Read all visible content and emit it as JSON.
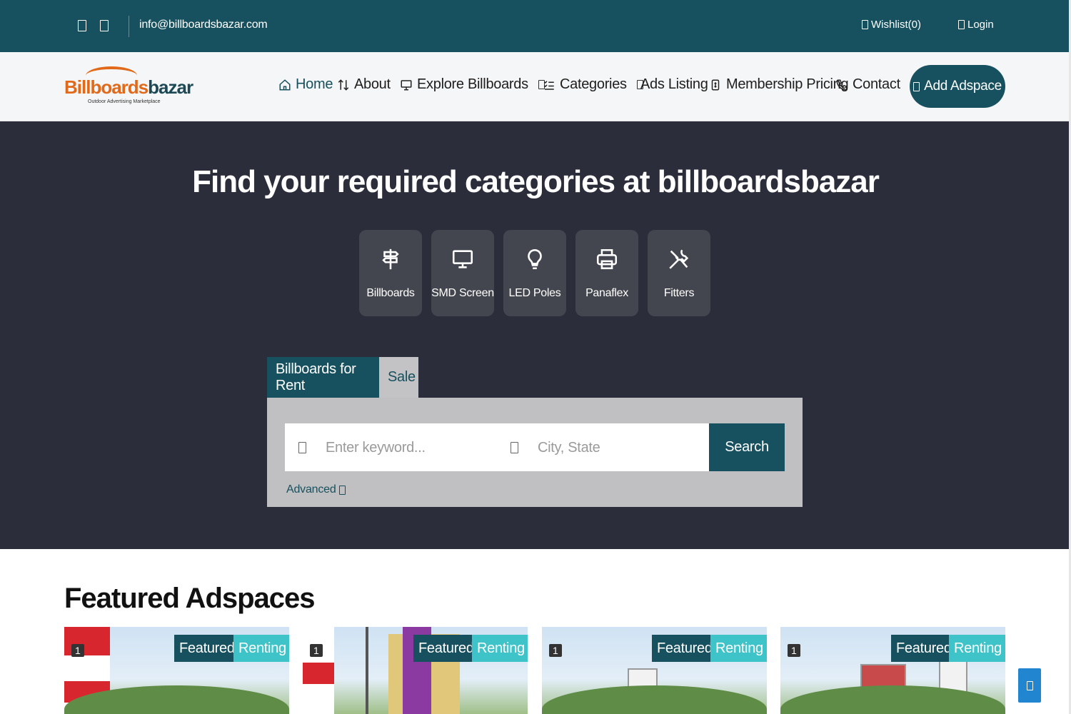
{
  "topbar": {
    "email": "info@billboardsbazar.com",
    "wishlist_label": "Wishlist(0)",
    "login_label": "Login",
    "social_icons": [
      "facebook-icon",
      "instagram-icon"
    ]
  },
  "brand": {
    "logo_part1": "Billboards",
    "logo_part2": "bazar",
    "tagline": "Outdoor Advertising Marketplace",
    "colors": {
      "primary": "#17505e",
      "accent": "#e06a1a",
      "hero_bg": "#2b2d3b",
      "teal_badge": "#3ec3c9"
    }
  },
  "nav": {
    "items": [
      {
        "label": "Home",
        "icon": "home-icon",
        "active": true
      },
      {
        "label": "About",
        "icon": "arrows-icon"
      },
      {
        "label": "Explore Billboards",
        "icon": "monitor-icon",
        "dropdown": true
      },
      {
        "label": "Categories",
        "icon": "list-check-icon",
        "dropdown": true
      },
      {
        "label": "Ads Listing"
      },
      {
        "label": "Membership Pricing",
        "icon": "bill-icon"
      },
      {
        "label": "Contact",
        "icon": "phone-icon"
      }
    ],
    "add_button": "Add Adspace"
  },
  "hero": {
    "title": "Find your required categories at billboardsbazar",
    "categories": [
      {
        "label": "Billboards",
        "icon": "signpost-icon"
      },
      {
        "label": "SMD Screen",
        "icon": "monitor-icon"
      },
      {
        "label": "LED Poles",
        "icon": "lightbulb-icon"
      },
      {
        "label": "Panaflex",
        "icon": "printer-icon"
      },
      {
        "label": "Fitters",
        "icon": "tools-icon"
      }
    ],
    "tabs": [
      "Billboards for Rent",
      "Sale"
    ],
    "search": {
      "keyword_placeholder": "Enter keyword...",
      "location_placeholder": "City, State",
      "button": "Search",
      "advanced": "Advanced"
    }
  },
  "featured": {
    "title": "Featured Adspaces",
    "cards": [
      {
        "badge_featured": "Featured",
        "badge_renting": "Renting",
        "count": "1"
      },
      {
        "badge_featured": "Featured",
        "badge_renting": "Renting",
        "count": "1"
      },
      {
        "badge_featured": "Featured",
        "badge_renting": "Renting",
        "count": "1"
      },
      {
        "badge_featured": "Featured",
        "badge_renting": "Renting",
        "count": "1"
      }
    ]
  }
}
